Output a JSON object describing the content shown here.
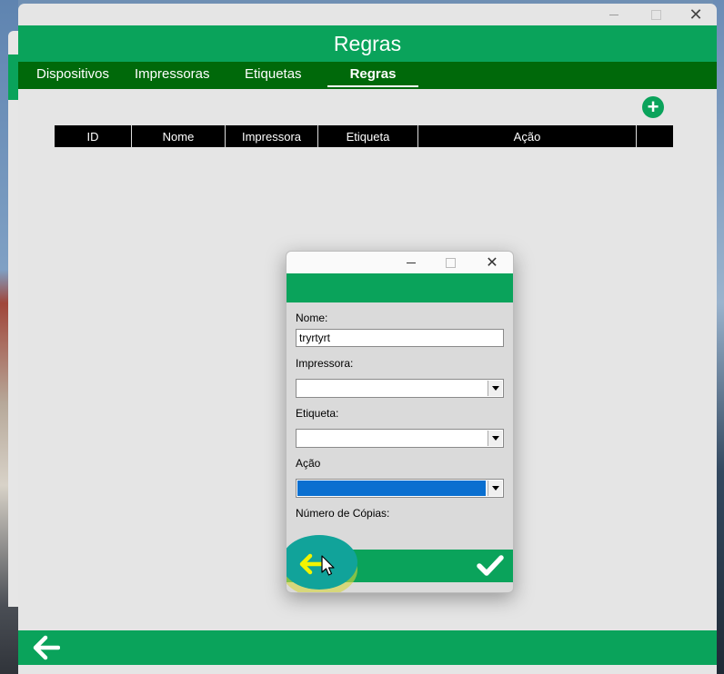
{
  "window": {
    "header_title": "Regras"
  },
  "nav": {
    "items": [
      {
        "label": "Dispositivos"
      },
      {
        "label": "Impressoras"
      },
      {
        "label": "Etiquetas"
      },
      {
        "label": "Regras",
        "active": true
      }
    ]
  },
  "table": {
    "columns": [
      "ID",
      "Nome",
      "Impressora",
      "Etiqueta",
      "Ação",
      ""
    ],
    "rows": []
  },
  "dialog": {
    "fields": {
      "nome_label": "Nome:",
      "nome_value": "tryrtyrt",
      "impressora_label": "Impressora:",
      "impressora_value": "",
      "etiqueta_label": "Etiqueta:",
      "etiqueta_value": "",
      "acao_label": "Ação",
      "acao_value": "",
      "copias_label": "Número de Cópias:"
    }
  },
  "icons": {
    "add": "plus-circle-icon",
    "back": "arrow-left-icon",
    "confirm": "checkmark-icon",
    "cursor": "mouse-pointer-icon"
  },
  "colors": {
    "primary_green": "#0aa35b",
    "nav_dark_green": "#00690a",
    "selection_blue": "#0a6fd0",
    "back_icon_yellow": "#f3f300"
  }
}
